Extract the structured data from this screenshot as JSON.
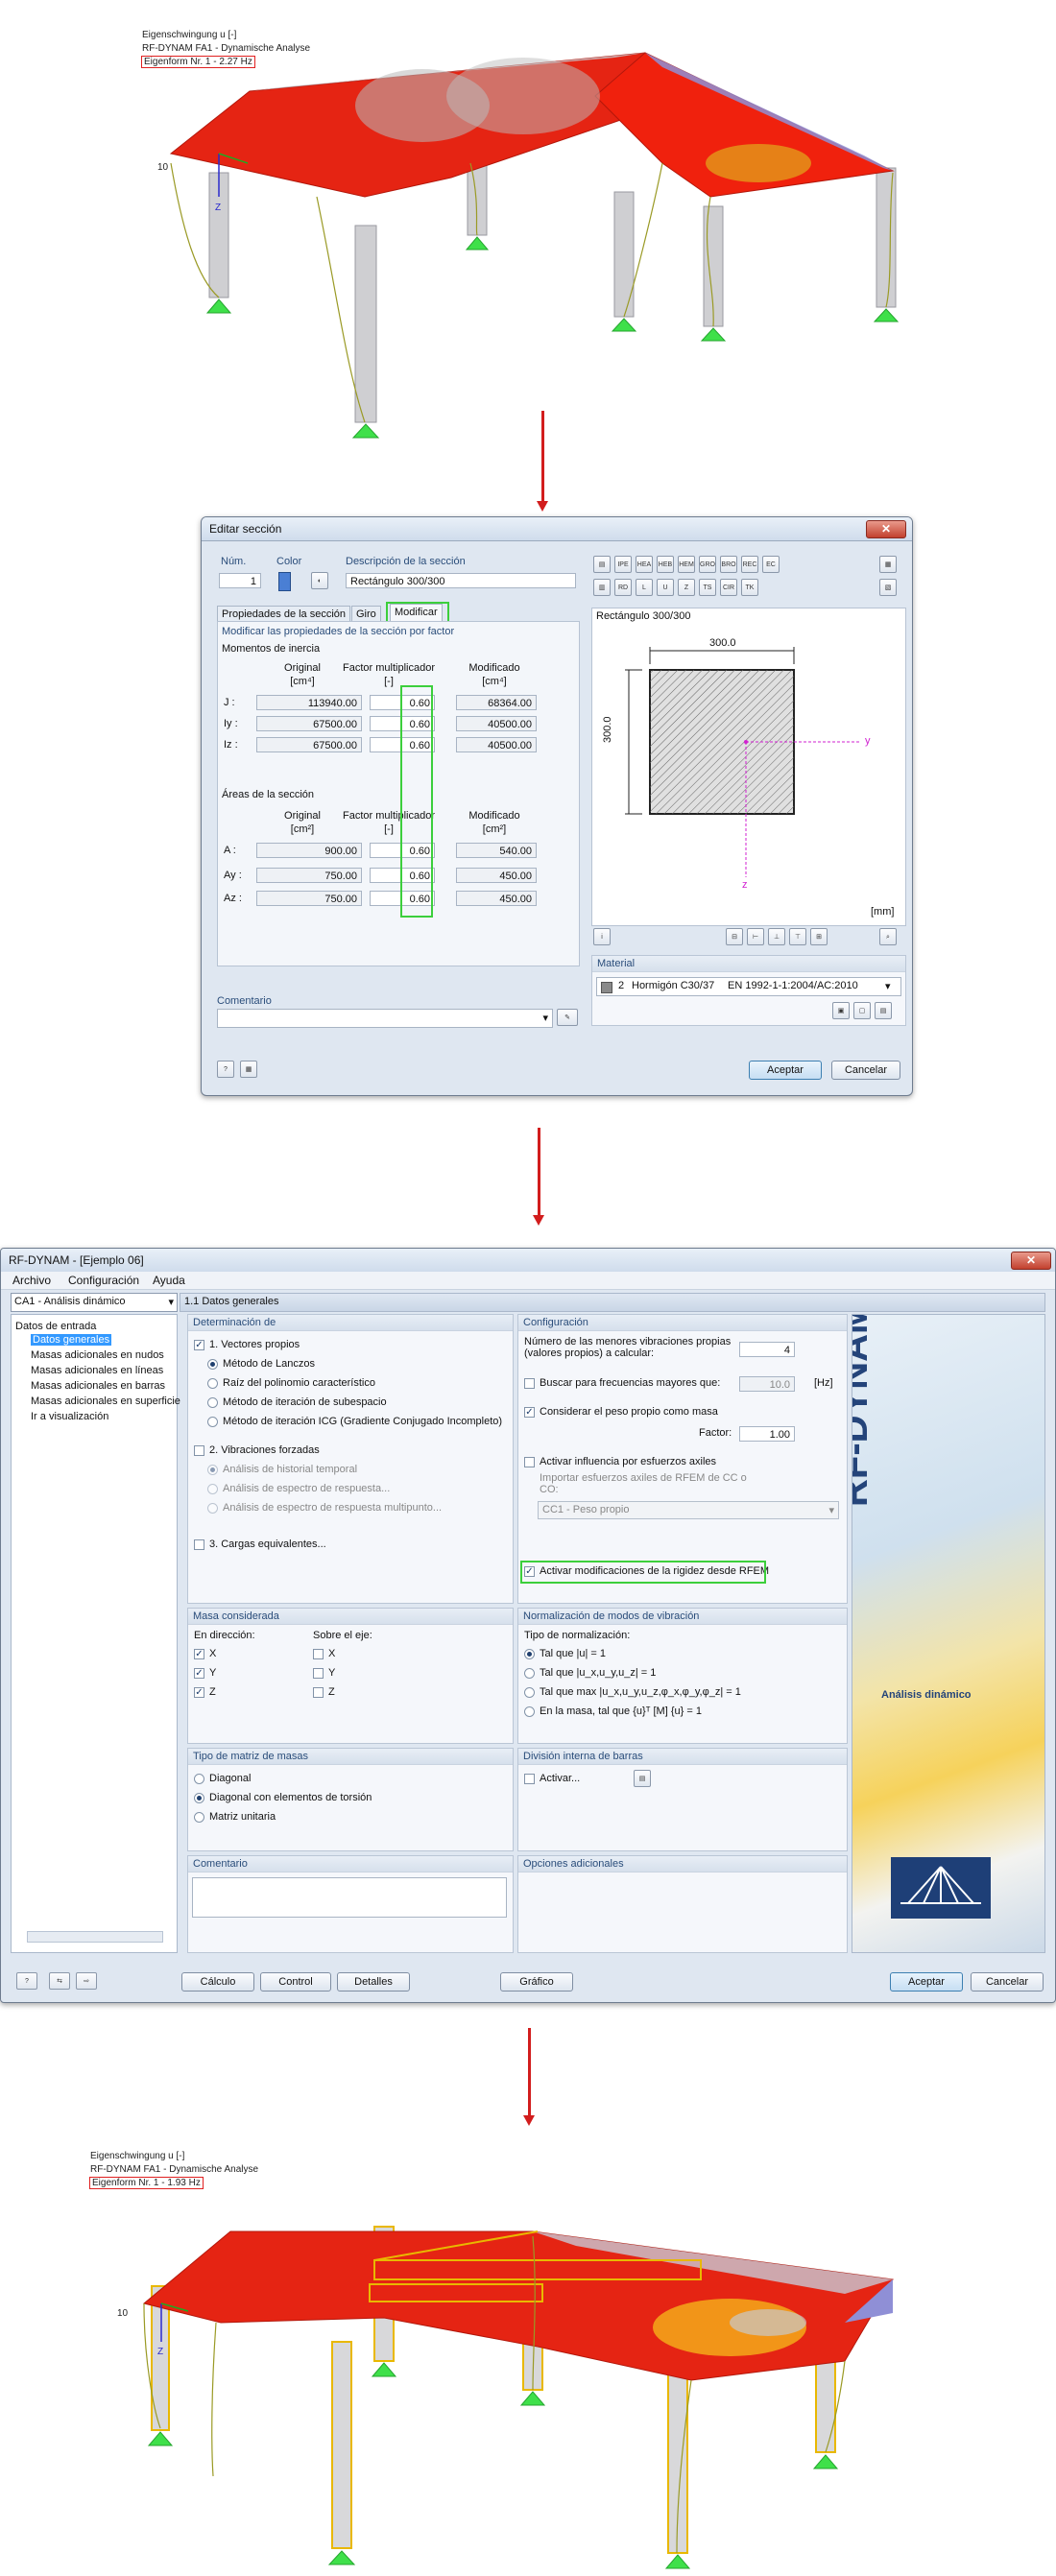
{
  "view1": {
    "line1": "Eigenschwingung u [-]",
    "line2": "RF-DYNAM FA1 - Dynamische Analyse",
    "eigenform": "Eigenform Nr. 1 - 2.27 Hz",
    "axis_num": "10",
    "axis_z": "Z"
  },
  "dialog": {
    "title": "Editar sección",
    "close": "✕",
    "num_label": "Núm.",
    "num_value": "1",
    "color_label": "Color",
    "desc_label": "Descripción de la sección",
    "desc_value": "Rectángulo 300/300",
    "tabs": [
      "Propiedades de la sección",
      "Giro",
      "Modificar"
    ],
    "modify_header": "Modificar las propiedades de la sección por factor",
    "inertia_title": "Momentos de inercia",
    "col_original": "Original",
    "col_factor": "Factor multiplicador",
    "col_modified": "Modificado",
    "unit_cm4": "[cm⁴]",
    "unit_cm2": "[cm²]",
    "unit_dash": "[-]",
    "areas_title": "Áreas de la sección",
    "rows_inertia": [
      {
        "label": "J :",
        "orig": "113940.00",
        "factor": "0.60",
        "mod": "68364.00"
      },
      {
        "label": "Iy :",
        "orig": "67500.00",
        "factor": "0.60",
        "mod": "40500.00"
      },
      {
        "label": "Iz :",
        "orig": "67500.00",
        "factor": "0.60",
        "mod": "40500.00"
      }
    ],
    "rows_area": [
      {
        "label": "A :",
        "orig": "900.00",
        "factor": "0.60",
        "mod": "540.00"
      },
      {
        "label": "Ay :",
        "orig": "750.00",
        "factor": "0.60",
        "mod": "450.00"
      },
      {
        "label": "Az :",
        "orig": "750.00",
        "factor": "0.60",
        "mod": "450.00"
      }
    ],
    "preview_title": "Rectángulo 300/300",
    "dim_w": "300.0",
    "dim_h": "300.0",
    "axis_y": "y",
    "axis_z": "z",
    "unit_mm": "[mm]",
    "material_label": "Material",
    "material_num": "2",
    "material_name": "Hormigón C30/37",
    "material_norm": "EN 1992-1-1:2004/AC:2010",
    "comment_label": "Comentario",
    "ok": "Aceptar",
    "cancel": "Cancelar",
    "toolbar_icons": [
      "IPE",
      "HEA",
      "HEB",
      "HEM",
      "GRO",
      "BRO",
      "REC",
      "EC",
      "RD",
      "L",
      "U",
      "Z",
      "TS",
      "CIR",
      "TK"
    ]
  },
  "main": {
    "title": "RF-DYNAM - [Ejemplo 06]",
    "menu": [
      "Archivo",
      "Configuración",
      "Ayuda"
    ],
    "case_select": "CA1 - Análisis dinámico",
    "section_title": "1.1 Datos generales",
    "tree": {
      "root": "Datos de entrada",
      "items": [
        "Datos generales",
        "Masas adicionales en nudos",
        "Masas adicionales en líneas",
        "Masas adicionales en barras",
        "Masas adicionales en superficie",
        "Ir a visualización"
      ]
    },
    "det": {
      "header": "Determinación de",
      "c1": "1. Vectores propios",
      "r1": "Método de Lanczos",
      "r2": "Raíz del polinomio característico",
      "r3": "Método de iteración de subespacio",
      "r4": "Método de iteración ICG (Gradiente Conjugado Incompleto)",
      "c2": "2. Vibraciones forzadas",
      "r5": "Análisis de historial temporal",
      "r6": "Análisis de espectro de respuesta...",
      "r7": "Análisis de espectro de respuesta multipunto...",
      "c3": "3. Cargas equivalentes..."
    },
    "config": {
      "header": "Configuración",
      "lowest_label": "Número de las menores vibraciones propias (valores propios) a calcular:",
      "lowest_value": "4",
      "freq_label": "Buscar para frecuencias mayores que:",
      "freq_value": "10.0",
      "freq_unit": "[Hz]",
      "selfweight": "Considerar el peso propio como masa",
      "factor_label": "Factor:",
      "factor_value": "1.00",
      "axial": "Activar influencia por esfuerzos axiles",
      "import_label": "Importar esfuerzos axiles de RFEM de CC o CO:",
      "import_value": "CC1 - Peso propio",
      "stiffness": "Activar modificaciones de la rigidez desde RFEM"
    },
    "mass": {
      "header": "Masa considerada",
      "dir_label": "En dirección:",
      "axis_label": "Sobre el eje:",
      "x": "X",
      "y": "Y",
      "z": "Z"
    },
    "norm": {
      "header": "Normalización de modos de vibración",
      "type_label": "Tipo de normalización:",
      "n1": "Tal que |u| = 1",
      "n2": "Tal que |u_x,u_y,u_z| = 1",
      "n3": "Tal que max |u_x,u_y,u_z,φ_x,φ_y,φ_z| = 1",
      "n4": "En la masa, tal que {u}ᵀ [M] {u} = 1"
    },
    "matrix": {
      "header": "Tipo de matriz de masas",
      "m1": "Diagonal",
      "m2": "Diagonal con elementos de torsión",
      "m3": "Matriz unitaria"
    },
    "division": {
      "header": "División interna de barras",
      "activate": "Activar..."
    },
    "comment_header": "Comentario",
    "options_header": "Opciones adicionales",
    "brand": "RF-DYNAM",
    "brand_sub": "Análisis dinámico",
    "btn_calc": "Cálculo",
    "btn_control": "Control",
    "btn_details": "Detalles",
    "btn_graph": "Gráfico",
    "btn_ok": "Aceptar",
    "btn_cancel": "Cancelar"
  },
  "view2": {
    "line1": "Eigenschwingung u [-]",
    "line2": "RF-DYNAM FA1 - Dynamische Analyse",
    "eigenform": "Eigenform Nr. 1 - 1.93 Hz",
    "axis_num": "10",
    "axis_z": "Z"
  }
}
